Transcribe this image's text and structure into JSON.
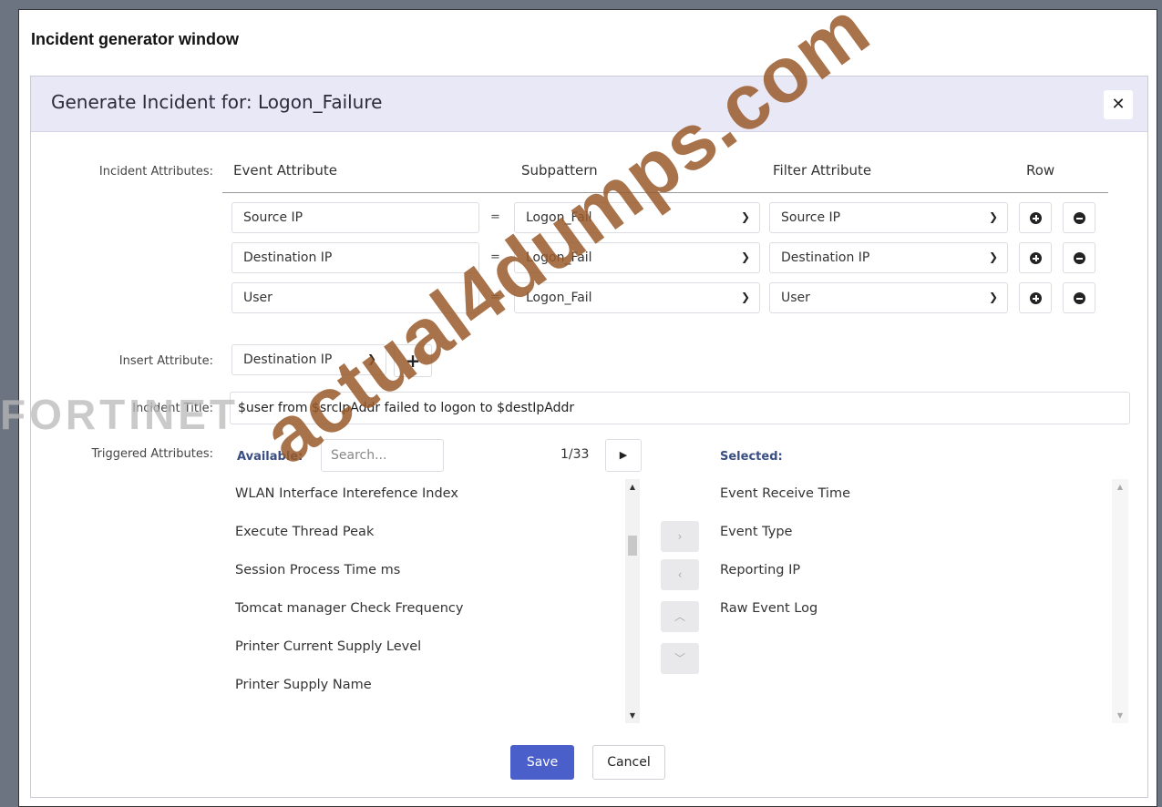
{
  "caption": "Incident generator window",
  "dialog": {
    "title": "Generate Incident for: Logon_Failure",
    "close_icon": "close-icon"
  },
  "labels": {
    "incident_attributes": "Incident Attributes:",
    "insert_attribute": "Insert Attribute:",
    "incident_title": "Incident Title:",
    "triggered_attributes": "Triggered Attributes:"
  },
  "columns": {
    "event_attribute": "Event Attribute",
    "subpattern": "Subpattern",
    "filter_attribute": "Filter Attribute",
    "row": "Row"
  },
  "rows": [
    {
      "event_attribute": "Source IP",
      "operator": "=",
      "subpattern": "Logon_Fail",
      "filter_attribute": "Source IP"
    },
    {
      "event_attribute": "Destination IP",
      "operator": "=",
      "subpattern": "Logon_Fail",
      "filter_attribute": "Destination IP"
    },
    {
      "event_attribute": "User",
      "operator": "=",
      "subpattern": "Logon_Fail",
      "filter_attribute": "User"
    }
  ],
  "insert_attribute": {
    "selected": "Destination IP"
  },
  "incident_title": {
    "value": "$user from $srcIpAddr failed to logon to $destIpAddr"
  },
  "triggered": {
    "available_label": "Available:",
    "search_placeholder": "Search...",
    "pager": "1/33",
    "selected_label": "Selected:",
    "available_items": [
      "WLAN Interface Interefence Index",
      "Execute Thread Peak",
      "Session Process Time ms",
      "Tomcat manager Check Frequency",
      "Printer Current Supply Level",
      "Printer Supply Name"
    ],
    "selected_items": [
      "Event Receive Time",
      "Event Type",
      "Reporting IP",
      "Raw Event Log"
    ]
  },
  "buttons": {
    "save": "Save",
    "cancel": "Cancel"
  },
  "watermarks": {
    "logo": "FORTINET",
    "site": "actual4dumps.com"
  },
  "colors": {
    "header_bg": "#e9e8f7",
    "save_bg": "#4a5fc9",
    "frame": "#6b7480"
  }
}
